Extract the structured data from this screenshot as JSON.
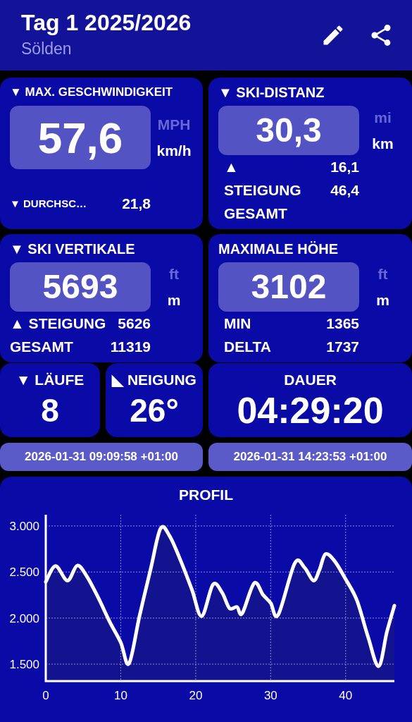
{
  "header": {
    "title": "Tag 1 2025/2026",
    "subtitle": "Sölden"
  },
  "stats": [
    {
      "title": "▼ MAX. GESCHWINDIGKEIT",
      "value": "57,6",
      "units": [
        {
          "label": "MPH",
          "selected": false
        },
        {
          "label": "km/h",
          "selected": true
        }
      ],
      "rows": [
        {
          "kind": "small",
          "label": "▼ DURCHSC…",
          "value": "21,8"
        }
      ]
    },
    {
      "title": "▼ SKI-DISTANZ",
      "value": "30,3",
      "units": [
        {
          "label": "mi",
          "selected": false
        },
        {
          "label": "km",
          "selected": true
        }
      ],
      "rows": [
        {
          "kind": "large",
          "label": "▲",
          "value": "16,1"
        },
        {
          "kind": "large",
          "label": "STEIGUNG",
          "value": "46,4"
        },
        {
          "kind": "large",
          "label": "GESAMT"
        }
      ]
    },
    {
      "title": "▼ SKI VERTIKALE",
      "value": "5693",
      "units": [
        {
          "label": "ft",
          "selected": false
        },
        {
          "label": "m",
          "selected": true
        }
      ],
      "rows": [
        {
          "kind": "large",
          "label": "▲ STEIGUNG",
          "value": "5626"
        },
        {
          "kind": "large",
          "label": "GESAMT",
          "value": "11319"
        }
      ]
    },
    {
      "title": "MAXIMALE HÖHE",
      "value": "3102",
      "units": [
        {
          "label": "ft",
          "selected": false
        },
        {
          "label": "m",
          "selected": true
        }
      ],
      "rows": [
        {
          "kind": "large",
          "label": "MIN",
          "value": "1365"
        },
        {
          "kind": "large",
          "label": "DELTA",
          "value": "1737"
        }
      ]
    }
  ],
  "small_stats": [
    {
      "title": "▼ LÄUFE",
      "value": "8"
    },
    {
      "title": "◣ NEIGUNG",
      "value": "26°"
    },
    {
      "title": "DAUER",
      "value": "04:29:20"
    }
  ],
  "times": [
    "2026-01-31 09:09:58 +01:00",
    "2026-01-31 14:23:53 +01:00"
  ],
  "profile": {
    "title": "PROFIL",
    "chart_data": {
      "type": "area",
      "x": [
        0,
        1.3,
        2.9,
        4.2,
        5.5,
        7,
        8.5,
        10,
        11.1,
        12.5,
        14,
        15.3,
        16.5,
        18,
        19.5,
        20.8,
        22.3,
        23.5,
        24.5,
        25.5,
        26.2,
        27.8,
        29,
        30,
        31,
        33.2,
        34.5,
        35.7,
        36.5,
        37.3,
        38.5,
        40,
        41.5,
        43,
        44.4,
        45.5,
        46.5
      ],
      "series": [
        {
          "color": "#ffffff",
          "values": [
            2393,
            2565,
            2407,
            2570,
            2450,
            2221,
            1964,
            1735,
            1506,
            2021,
            2536,
            2971,
            2894,
            2622,
            2307,
            2021,
            2364,
            2279,
            2107,
            2121,
            2050,
            2379,
            2250,
            2164,
            2035,
            2593,
            2550,
            2407,
            2522,
            2694,
            2622,
            2422,
            2193,
            1792,
            1477,
            1850,
            2135
          ]
        }
      ],
      "grid": true,
      "xlim": [
        0,
        46.5
      ],
      "ylim": [
        1316,
        3122
      ],
      "xticks": [
        0,
        10,
        20,
        30,
        40
      ],
      "yticks": [
        {
          "value": 1500,
          "label": "1.500"
        },
        {
          "value": 2000,
          "label": "2.000"
        },
        {
          "value": 2500,
          "label": "2.500"
        },
        {
          "value": 3000,
          "label": "3.000"
        }
      ]
    }
  }
}
